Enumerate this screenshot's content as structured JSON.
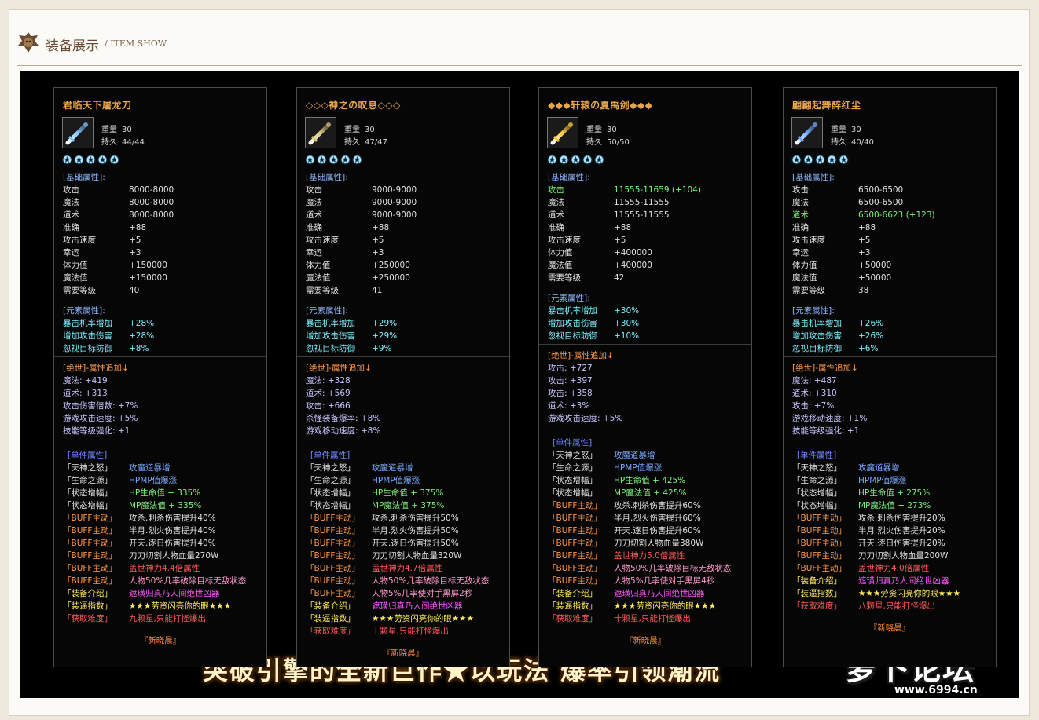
{
  "header": {
    "title": "装备展示",
    "subtitle": "/ ITEM SHOW"
  },
  "labels": {
    "weight": "重量",
    "durability": "持久",
    "base_section": "[基础属性]:",
    "elem_section": "[元素属性]:",
    "set_section": "[单件属性]"
  },
  "colors": {
    "accent": "#e8a44a",
    "background": "#000000"
  },
  "panels": [
    {
      "name": "君临天下屠龙刀",
      "weight": "30",
      "durability": "44/44",
      "stars": 5,
      "icon": "blue-sword-icon",
      "icon_color": "#7fc4ff",
      "base": [
        {
          "k": "攻击",
          "v": "8000-8000",
          "hl": false
        },
        {
          "k": "魔法",
          "v": "8000-8000",
          "hl": false
        },
        {
          "k": "道术",
          "v": "8000-8000",
          "hl": false
        },
        {
          "k": "准确",
          "v": "+88",
          "hl": false
        },
        {
          "k": "攻击速度",
          "v": "+5",
          "hl": false
        },
        {
          "k": "幸运",
          "v": "+3",
          "hl": false
        },
        {
          "k": "体力值",
          "v": "+150000",
          "hl": false
        },
        {
          "k": "魔法值",
          "v": "+150000",
          "hl": false
        },
        {
          "k": "需要等级",
          "v": "40",
          "hl": false
        }
      ],
      "elem": [
        {
          "k": "暴击机率增加",
          "v": "+28%"
        },
        {
          "k": "增加攻击伤害",
          "v": "+28%"
        },
        {
          "k": "忽视目标防御",
          "v": "+8%"
        }
      ],
      "jueshi_title": "[绝世]-属性追加↓",
      "jueshi": [
        "魔法: +419",
        "道术: +313",
        "攻击伤害倍数: +7%",
        "游戏攻击速度: +5%",
        "技能等级强化: +1"
      ],
      "set": [
        {
          "k": "「天神之怒」",
          "v": "攻魔道暴增",
          "kc": "c-w",
          "vc": "c-bl"
        },
        {
          "k": "「生命之源」",
          "v": "HPMP值爆涨",
          "kc": "c-w",
          "vc": "c-bl"
        },
        {
          "k": "「状态增幅」",
          "v": "HP生命值 + 335%",
          "kc": "c-w",
          "vc": "c-gr"
        },
        {
          "k": "「状态增幅」",
          "v": "MP魔法值 + 335%",
          "kc": "c-w",
          "vc": "c-gr"
        },
        {
          "k": "「BUFF主动」",
          "v": "攻杀.刺杀伤害提升40%",
          "kc": "c-or",
          "vc": "c-w"
        },
        {
          "k": "「BUFF主动」",
          "v": "半月.烈火伤害提升40%",
          "kc": "c-or",
          "vc": "c-w"
        },
        {
          "k": "「BUFF主动」",
          "v": "开天.逐日伤害提升40%",
          "kc": "c-or",
          "vc": "c-w"
        },
        {
          "k": "「BUFF主动」",
          "v": "刀刀切割人物血量270W",
          "kc": "c-or",
          "vc": "c-w"
        },
        {
          "k": "「BUFF主动」",
          "v": "盖世神力4.4倍属性",
          "kc": "c-or",
          "vc": "c-rd"
        },
        {
          "k": "「BUFF主动」",
          "v": "人物50%几率破除目标无敌状态",
          "kc": "c-or",
          "vc": "c-pk"
        },
        {
          "k": "「装备介绍」",
          "v": "遮璜归真乃人间绝世凶器",
          "kc": "c-yl",
          "vc": "c-mg"
        },
        {
          "k": "「装逼指数」",
          "v": "★★★劳资闪亮你的眼★★★",
          "kc": "c-yl",
          "vc": "c-yl"
        },
        {
          "k": "「获取难度」",
          "v": "九颗星,只能打怪爆出",
          "kc": "c-rd",
          "vc": "c-rd"
        }
      ],
      "sign": "『新晓晨』"
    },
    {
      "name": "◇◇◇神之の叹息◇◇◇",
      "weight": "30",
      "durability": "47/47",
      "stars": 5,
      "icon": "golden-staff-icon",
      "icon_color": "#d8c27a",
      "base": [
        {
          "k": "攻击",
          "v": "9000-9000",
          "hl": false
        },
        {
          "k": "魔法",
          "v": "9000-9000",
          "hl": false
        },
        {
          "k": "道术",
          "v": "9000-9000",
          "hl": false
        },
        {
          "k": "准确",
          "v": "+88",
          "hl": false
        },
        {
          "k": "攻击速度",
          "v": "+5",
          "hl": false
        },
        {
          "k": "幸运",
          "v": "+3",
          "hl": false
        },
        {
          "k": "体力值",
          "v": "+250000",
          "hl": false
        },
        {
          "k": "魔法值",
          "v": "+250000",
          "hl": false
        },
        {
          "k": "需要等级",
          "v": "41",
          "hl": false
        }
      ],
      "elem": [
        {
          "k": "暴击机率增加",
          "v": "+29%"
        },
        {
          "k": "增加攻击伤害",
          "v": "+29%"
        },
        {
          "k": "忽视目标防御",
          "v": "+9%"
        }
      ],
      "jueshi_title": "[绝世]-属性追加↓",
      "jueshi": [
        "魔法: +328",
        "道术: +569",
        "攻击: +666",
        "杀怪装备爆率: +8%",
        "游戏移动速度: +8%"
      ],
      "set": [
        {
          "k": "「天神之怒」",
          "v": "攻魔道暴增",
          "kc": "c-w",
          "vc": "c-bl"
        },
        {
          "k": "「生命之源」",
          "v": "HPMP值爆涨",
          "kc": "c-w",
          "vc": "c-bl"
        },
        {
          "k": "「状态增幅」",
          "v": "HP生命值 + 375%",
          "kc": "c-w",
          "vc": "c-gr"
        },
        {
          "k": "「状态增幅」",
          "v": "MP魔法值 + 375%",
          "kc": "c-w",
          "vc": "c-gr"
        },
        {
          "k": "「BUFF主动」",
          "v": "攻杀.刺杀伤害提升50%",
          "kc": "c-or",
          "vc": "c-w"
        },
        {
          "k": "「BUFF主动」",
          "v": "半月.烈火伤害提升50%",
          "kc": "c-or",
          "vc": "c-w"
        },
        {
          "k": "「BUFF主动」",
          "v": "开天.逐日伤害提升50%",
          "kc": "c-or",
          "vc": "c-w"
        },
        {
          "k": "「BUFF主动」",
          "v": "刀刀切割人物血量320W",
          "kc": "c-or",
          "vc": "c-w"
        },
        {
          "k": "「BUFF主动」",
          "v": "盖世神力4.7倍属性",
          "kc": "c-or",
          "vc": "c-rd"
        },
        {
          "k": "「BUFF主动」",
          "v": "人物50%几率破除目标无敌状态",
          "kc": "c-or",
          "vc": "c-pk"
        },
        {
          "k": "「BUFF主动」",
          "v": "人物5%几率使对手黑屏2秒",
          "kc": "c-or",
          "vc": "c-pk"
        },
        {
          "k": "「装备介绍」",
          "v": "遮璜归真乃人间绝世凶器",
          "kc": "c-yl",
          "vc": "c-mg"
        },
        {
          "k": "「装逼指数」",
          "v": "★★★劳资闪亮你的眼★★★",
          "kc": "c-yl",
          "vc": "c-yl"
        },
        {
          "k": "「获取难度」",
          "v": "十颗星,只能打怪爆出",
          "kc": "c-rd",
          "vc": "c-rd"
        }
      ],
      "sign": "『新晓晨』"
    },
    {
      "name": "◆◆◆轩辕の夏禹剑◆◆◆",
      "weight": "30",
      "durability": "50/50",
      "stars": 5,
      "icon": "golden-sword-icon",
      "icon_color": "#ffcc33",
      "base": [
        {
          "k": "攻击",
          "v": "11555-11659 (+104)",
          "hl": true
        },
        {
          "k": "魔法",
          "v": "11555-11555",
          "hl": false
        },
        {
          "k": "道术",
          "v": "11555-11555",
          "hl": false
        },
        {
          "k": "准确",
          "v": "+88",
          "hl": false
        },
        {
          "k": "攻击速度",
          "v": "+5",
          "hl": false
        },
        {
          "k": "体力值",
          "v": "+400000",
          "hl": false
        },
        {
          "k": "魔法值",
          "v": "+400000",
          "hl": false
        },
        {
          "k": "需要等级",
          "v": "42",
          "hl": false
        }
      ],
      "elem": [
        {
          "k": "暴击机率增加",
          "v": "+30%"
        },
        {
          "k": "增加攻击伤害",
          "v": "+30%"
        },
        {
          "k": "忽视目标防御",
          "v": "+10%"
        }
      ],
      "jueshi_title": "[绝世]-属性追加↓",
      "jueshi": [
        "攻击: +727",
        "攻击: +397",
        "攻击: +358",
        "道术: +3%",
        "游戏攻击速度: +5%"
      ],
      "set": [
        {
          "k": "「天神之怒」",
          "v": "攻魔道暴增",
          "kc": "c-w",
          "vc": "c-bl"
        },
        {
          "k": "「生命之源」",
          "v": "HPMP值爆涨",
          "kc": "c-w",
          "vc": "c-bl"
        },
        {
          "k": "「状态增幅」",
          "v": "HP生命值 + 425%",
          "kc": "c-w",
          "vc": "c-gr"
        },
        {
          "k": "「状态增幅」",
          "v": "MP魔法值 + 425%",
          "kc": "c-w",
          "vc": "c-gr"
        },
        {
          "k": "「BUFF主动」",
          "v": "攻杀.刺杀伤害提升60%",
          "kc": "c-or",
          "vc": "c-w"
        },
        {
          "k": "「BUFF主动」",
          "v": "半月.烈火伤害提升60%",
          "kc": "c-or",
          "vc": "c-w"
        },
        {
          "k": "「BUFF主动」",
          "v": "开天.逐日伤害提升60%",
          "kc": "c-or",
          "vc": "c-w"
        },
        {
          "k": "「BUFF主动」",
          "v": "刀刀切割人物血量380W",
          "kc": "c-or",
          "vc": "c-w"
        },
        {
          "k": "「BUFF主动」",
          "v": "盖世神力5.0倍属性",
          "kc": "c-or",
          "vc": "c-rd"
        },
        {
          "k": "「BUFF主动」",
          "v": "人物50%几率破除目标无敌状态",
          "kc": "c-or",
          "vc": "c-pk"
        },
        {
          "k": "「BUFF主动」",
          "v": "人物5%几率使对手黑屏4秒",
          "kc": "c-or",
          "vc": "c-pk"
        },
        {
          "k": "「装备介绍」",
          "v": "遮璜归真乃人间绝世凶器",
          "kc": "c-yl",
          "vc": "c-mg"
        },
        {
          "k": "「装逼指数」",
          "v": "★★★劳资闪亮你的眼★★★",
          "kc": "c-yl",
          "vc": "c-yl"
        },
        {
          "k": "「获取难度」",
          "v": "十颗星,只能打怪爆出",
          "kc": "c-rd",
          "vc": "c-rd"
        }
      ],
      "sign": "『新晓晨』"
    },
    {
      "name": "翩翩起舞醉红尘",
      "weight": "30",
      "durability": "40/40",
      "stars": 5,
      "icon": "crystal-blade-icon",
      "icon_color": "#6fa8ff",
      "base": [
        {
          "k": "攻击",
          "v": "6500-6500",
          "hl": false
        },
        {
          "k": "魔法",
          "v": "6500-6500",
          "hl": false
        },
        {
          "k": "道术",
          "v": "6500-6623 (+123)",
          "hl": true
        },
        {
          "k": "准确",
          "v": "+88",
          "hl": false
        },
        {
          "k": "攻击速度",
          "v": "+5",
          "hl": false
        },
        {
          "k": "幸运",
          "v": "+3",
          "hl": false
        },
        {
          "k": "体力值",
          "v": "+50000",
          "hl": false
        },
        {
          "k": "魔法值",
          "v": "+50000",
          "hl": false
        },
        {
          "k": "需要等级",
          "v": "38",
          "hl": false
        }
      ],
      "elem": [
        {
          "k": "暴击机率增加",
          "v": "+26%"
        },
        {
          "k": "增加攻击伤害",
          "v": "+26%"
        },
        {
          "k": "忽视目标防御",
          "v": "+6%"
        }
      ],
      "jueshi_title": "[绝世]-属性追加↓",
      "jueshi": [
        "魔法: +487",
        "道术: +310",
        "攻击: +7%",
        "游戏移动速度: +1%",
        "技能等级强化: +1"
      ],
      "set": [
        {
          "k": "「天神之怒」",
          "v": "攻魔道暴增",
          "kc": "c-w",
          "vc": "c-bl"
        },
        {
          "k": "「生命之源」",
          "v": "HPMP值爆涨",
          "kc": "c-w",
          "vc": "c-bl"
        },
        {
          "k": "「状态增幅」",
          "v": "HP生命值 + 275%",
          "kc": "c-w",
          "vc": "c-gr"
        },
        {
          "k": "「状态增幅」",
          "v": "MP魔法值 + 273%",
          "kc": "c-w",
          "vc": "c-gr"
        },
        {
          "k": "「BUFF主动」",
          "v": "攻杀.刺杀伤害提升20%",
          "kc": "c-or",
          "vc": "c-w"
        },
        {
          "k": "「BUFF主动」",
          "v": "半月.烈火伤害提升20%",
          "kc": "c-or",
          "vc": "c-w"
        },
        {
          "k": "「BUFF主动」",
          "v": "开天.逐日伤害提升20%",
          "kc": "c-or",
          "vc": "c-w"
        },
        {
          "k": "「BUFF主动」",
          "v": "刀刀切割人物血量200W",
          "kc": "c-or",
          "vc": "c-w"
        },
        {
          "k": "「BUFF主动」",
          "v": "盖世神力4.0倍属性",
          "kc": "c-or",
          "vc": "c-rd"
        },
        {
          "k": "「装备介绍」",
          "v": "遮璜归真乃人间绝世凶器",
          "kc": "c-yl",
          "vc": "c-mg"
        },
        {
          "k": "「装逼指数」",
          "v": "★★★劳资闪亮你的眼★★★",
          "kc": "c-yl",
          "vc": "c-yl"
        },
        {
          "k": "「获取难度」",
          "v": "八颗星,只能打怪爆出",
          "kc": "c-rd",
          "vc": "c-rd"
        }
      ],
      "sign": "『新晓晨』"
    }
  ],
  "banner": {
    "slogan": "突破引擎的全新巨作★以玩法 爆率引领潮流",
    "logo_text": "萝卜论坛",
    "url": "www.6994.cn"
  }
}
